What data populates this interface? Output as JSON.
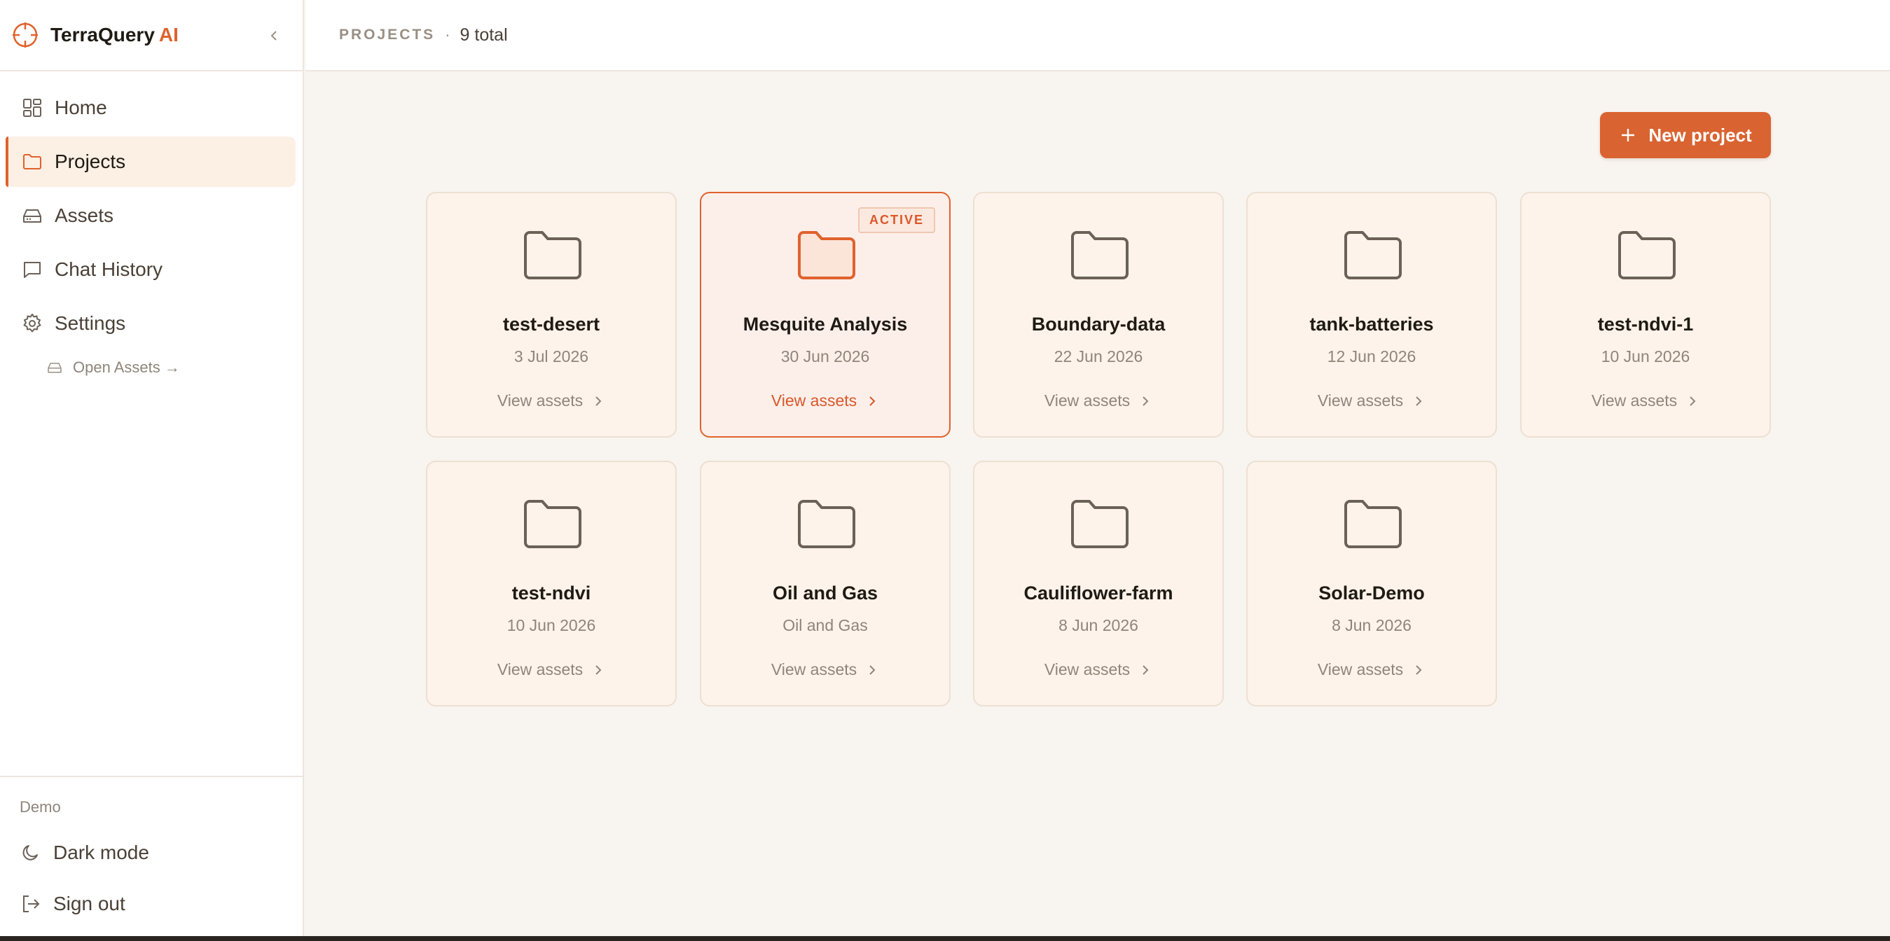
{
  "brand": {
    "name": "TerraQuery",
    "suffix": "AI",
    "accent": "#e0622d"
  },
  "sidebar": {
    "items": [
      {
        "label": "Home",
        "icon": "grid-icon"
      },
      {
        "label": "Projects",
        "icon": "folder-icon",
        "active": true
      },
      {
        "label": "Assets",
        "icon": "drive-icon"
      },
      {
        "label": "Chat History",
        "icon": "chat-icon"
      },
      {
        "label": "Settings",
        "icon": "gear-icon"
      }
    ],
    "sub_link": {
      "label": "Open Assets →",
      "icon": "drive-icon"
    },
    "footer": {
      "label": "Demo",
      "dark_mode": "Dark mode",
      "sign_out": "Sign out"
    }
  },
  "header": {
    "section": "PROJECTS",
    "separator": "·",
    "count": "9 total"
  },
  "toolbar": {
    "new_project": "New project"
  },
  "projects": [
    {
      "name": "test-desert",
      "date": "3 Jul 2026",
      "link": "View assets"
    },
    {
      "name": "Mesquite Analysis",
      "date": "30 Jun 2026",
      "link": "View assets",
      "badge": "ACTIVE",
      "active": true
    },
    {
      "name": "Boundary-data",
      "date": "22 Jun 2026",
      "link": "View assets"
    },
    {
      "name": "tank-batteries",
      "date": "12 Jun 2026",
      "link": "View assets"
    },
    {
      "name": "test-ndvi-1",
      "date": "10 Jun 2026",
      "link": "View assets"
    },
    {
      "name": "test-ndvi",
      "date": "10 Jun 2026",
      "link": "View assets"
    },
    {
      "name": "Oil and Gas",
      "date": "Oil and Gas",
      "link": "View assets"
    },
    {
      "name": "Cauliflower-farm",
      "date": "8 Jun 2026",
      "link": "View assets"
    },
    {
      "name": "Solar-Demo",
      "date": "8 Jun 2026",
      "link": "View assets"
    }
  ]
}
